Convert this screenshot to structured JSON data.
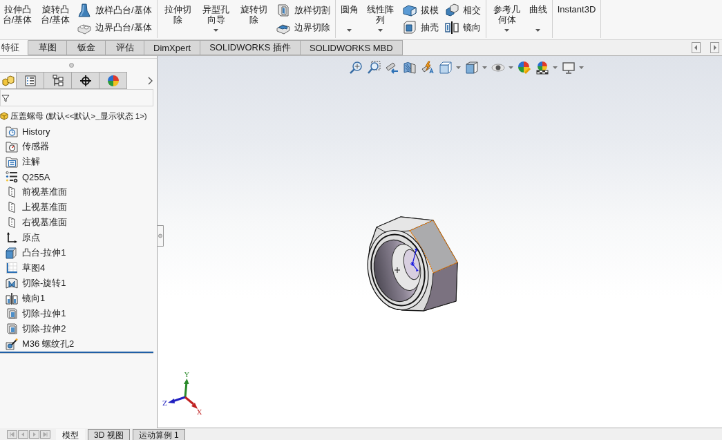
{
  "ribbon": {
    "groups": [
      {
        "items": [
          {
            "kind": "large",
            "label": "拉伸凸台/基体",
            "dropdown": false
          },
          {
            "kind": "large",
            "label": "旋转凸台/基体",
            "dropdown": false
          },
          {
            "kind": "stack",
            "buttons": [
              {
                "label": "放样凸台/基体"
              },
              {
                "label": "边界凸台/基体"
              }
            ]
          }
        ]
      },
      {
        "items": [
          {
            "kind": "large",
            "label": "拉伸切除",
            "dropdown": false
          },
          {
            "kind": "large",
            "label": "异型孔向导",
            "dropdown": true
          },
          {
            "kind": "large",
            "label": "旋转切除",
            "dropdown": false
          },
          {
            "kind": "stack",
            "buttons": [
              {
                "label": "放样切割"
              },
              {
                "label": "边界切除"
              }
            ]
          }
        ]
      },
      {
        "items": [
          {
            "kind": "large",
            "label": "圆角",
            "dropdown": true
          },
          {
            "kind": "large",
            "label": "线性阵列",
            "dropdown": true
          },
          {
            "kind": "stack",
            "buttons": [
              {
                "label": "拔模"
              },
              {
                "label": "抽壳"
              }
            ]
          },
          {
            "kind": "stack",
            "buttons": [
              {
                "label": "相交"
              },
              {
                "label": "镜向"
              }
            ]
          }
        ]
      },
      {
        "items": [
          {
            "kind": "large",
            "label": "参考几何体",
            "dropdown": true
          },
          {
            "kind": "large",
            "label": "曲线",
            "dropdown": true
          }
        ]
      },
      {
        "items": [
          {
            "kind": "large",
            "label": "Instant3D",
            "dropdown": false
          }
        ]
      }
    ]
  },
  "command_tabs": [
    {
      "label": "特征",
      "selected": true
    },
    {
      "label": "草图",
      "selected": false
    },
    {
      "label": "钣金",
      "selected": false
    },
    {
      "label": "评估",
      "selected": false
    },
    {
      "label": "DimXpert",
      "selected": false
    },
    {
      "label": "SOLIDWORKS 插件",
      "selected": false
    },
    {
      "label": "SOLIDWORKS MBD",
      "selected": false
    }
  ],
  "feature_tree": {
    "tabs": [
      {
        "selected": true
      },
      {
        "selected": false
      },
      {
        "selected": false
      },
      {
        "selected": false
      },
      {
        "selected": false
      }
    ],
    "root": {
      "label": "压盖螺母 (默认<<默认>_显示状态 1>)",
      "children": [
        {
          "kind": "history",
          "label": "History"
        },
        {
          "kind": "sensors",
          "label": "传感器"
        },
        {
          "kind": "annotations",
          "label": "注解"
        },
        {
          "kind": "material",
          "label": "Q255A"
        },
        {
          "kind": "plane",
          "label": "前视基准面"
        },
        {
          "kind": "plane",
          "label": "上视基准面"
        },
        {
          "kind": "plane",
          "label": "右视基准面"
        },
        {
          "kind": "origin",
          "label": "原点"
        },
        {
          "kind": "extrude",
          "label": "凸台-拉伸1"
        },
        {
          "kind": "sketch",
          "label": "草图4"
        },
        {
          "kind": "revolve",
          "label": "切除-旋转1"
        },
        {
          "kind": "mirror",
          "label": "镜向1"
        },
        {
          "kind": "cut",
          "label": "切除-拉伸1"
        },
        {
          "kind": "cut",
          "label": "切除-拉伸2"
        },
        {
          "kind": "hole",
          "label": "M36 螺纹孔2"
        }
      ]
    }
  },
  "view_toolbar": [
    {
      "dropdown": false
    },
    {
      "dropdown": false
    },
    {
      "dropdown": false
    },
    {
      "dropdown": false
    },
    {
      "dropdown": false
    },
    {
      "dropdown": true
    },
    {
      "dropdown": true
    },
    {
      "dropdown": true
    },
    {
      "dropdown": false
    },
    {
      "dropdown": true
    },
    {
      "dropdown": true
    }
  ],
  "viewport": {
    "triad": {
      "x": "X",
      "y": "Y",
      "z": "Z"
    }
  },
  "bottom_tabs": [
    {
      "label": "模型",
      "selected": true
    },
    {
      "label": "3D 视图",
      "selected": false
    },
    {
      "label": "运动算例 1",
      "selected": false
    }
  ]
}
